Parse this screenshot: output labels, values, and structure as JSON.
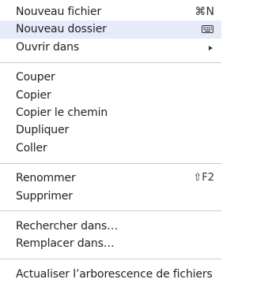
{
  "menu": {
    "group1": [
      {
        "label": "Nouveau fichier",
        "shortcut": "⌘N"
      },
      {
        "label": "Nouveau dossier",
        "shortcut_icon": "keyboard-icon",
        "highlighted": true
      },
      {
        "label": "Ouvrir dans",
        "submenu_icon": "submenu-arrow-icon"
      }
    ],
    "group2": [
      {
        "label": "Couper"
      },
      {
        "label": "Copier"
      },
      {
        "label": "Copier le chemin"
      },
      {
        "label": "Dupliquer"
      },
      {
        "label": "Coller"
      }
    ],
    "group3": [
      {
        "label": "Renommer",
        "shortcut": "⇧F2"
      },
      {
        "label": "Supprimer"
      }
    ],
    "group4": [
      {
        "label": "Rechercher dans…"
      },
      {
        "label": "Remplacer dans…"
      }
    ],
    "group5": [
      {
        "label": "Actualiser l’arborescence de fichiers"
      }
    ]
  },
  "colors": {
    "highlight": "#e7eaf9",
    "separator": "#c9c9c9",
    "text": "#222222"
  }
}
